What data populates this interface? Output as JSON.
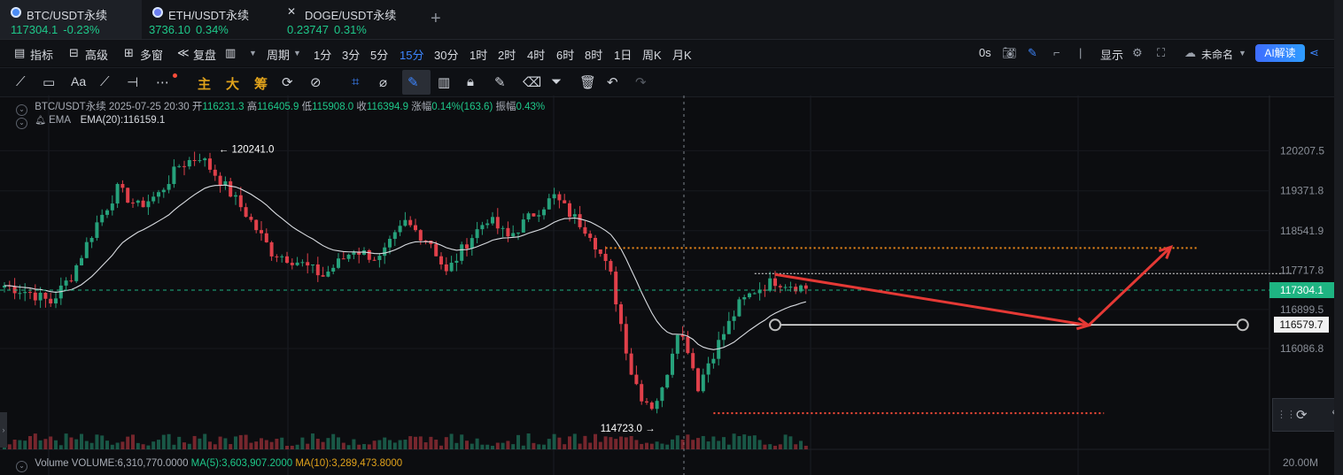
{
  "tabs": [
    {
      "symbol": "BTC/USDT永续",
      "price": "117304.1",
      "change": "-0.23%",
      "icon": "btc-logo-icon",
      "active": true
    },
    {
      "symbol": "ETH/USDT永续",
      "price": "3736.10",
      "change": "0.34%",
      "icon": "eth-logo-icon",
      "active": false
    },
    {
      "symbol": "DOGE/USDT永续",
      "price": "0.23747",
      "change": "0.31%",
      "icon": "close-icon",
      "active": false
    }
  ],
  "add_tab": "+",
  "toolbar": {
    "indicator": "指标",
    "advanced": "高级",
    "multi_window": "多窗",
    "replay": "复盘",
    "period": "周期",
    "intervals": [
      "1分",
      "3分",
      "5分",
      "15分",
      "30分",
      "1时",
      "2时",
      "4时",
      "6时",
      "8时",
      "1日",
      "周K",
      "月K"
    ],
    "active_interval": "15分",
    "countdown": "0s",
    "display": "显示",
    "unnamed": "未命名",
    "ai": "AI解读"
  },
  "draw_tools": {
    "main": "主",
    "big": "大",
    "chip": "筹",
    "text_tool": "Aa"
  },
  "legend": {
    "symbol": "BTC/USDT永续",
    "datetime": "2025-07-25 20:30",
    "open_label": "开",
    "open": "116231.3",
    "high_label": "高",
    "high": "116405.9",
    "low_label": "低",
    "low": "115908.0",
    "close_label": "收",
    "close": "116394.9",
    "change_label": "涨幅",
    "change": "0.14%(163.6)",
    "amplitude_label": "振幅",
    "amplitude": "0.43%",
    "ema_name": "EMA",
    "ema_value": "EMA(20):116159.1"
  },
  "volume_legend": {
    "name": "Volume",
    "volume": "VOLUME:6,310,770.0000",
    "ma5": "MA(5):3,603,907.2000",
    "ma10": "MA(10):3,289,473.8000"
  },
  "annotations": {
    "high_text": "120241.0",
    "low_text": "114723.0"
  },
  "price_tag": "117304.1",
  "line_tag": "116579.7",
  "colors": {
    "up": "#26a17b",
    "down": "#e0404a",
    "ema": "#d9dce1",
    "accent": "#3d86ff",
    "orange_level": "#f08a1a",
    "red_level": "#ff4d3a",
    "arrow": "#e53935"
  },
  "chart_data": {
    "type": "candlestick",
    "ylim": [
      114540,
      120620
    ],
    "y_ticks": [
      "120207.5",
      "119371.8",
      "118541.9",
      "117717.8",
      "116899.5",
      "116086.8"
    ],
    "volume_tick": "20.00M",
    "current_price": 117304.1,
    "key_points": [
      [
        0,
        117400
      ],
      [
        5,
        117250
      ],
      [
        9,
        117050
      ],
      [
        13,
        117600
      ],
      [
        18,
        118700
      ],
      [
        22,
        119400
      ],
      [
        26,
        119050
      ],
      [
        30,
        119300
      ],
      [
        34,
        119900
      ],
      [
        38,
        120100
      ],
      [
        42,
        119600
      ],
      [
        47,
        118900
      ],
      [
        52,
        118100
      ],
      [
        57,
        117900
      ],
      [
        62,
        117600
      ],
      [
        68,
        118150
      ],
      [
        73,
        117950
      ],
      [
        78,
        118700
      ],
      [
        83,
        118300
      ],
      [
        86,
        117650
      ],
      [
        90,
        118300
      ],
      [
        94,
        118800
      ],
      [
        98,
        118400
      ],
      [
        103,
        118900
      ],
      [
        107,
        119250
      ],
      [
        110,
        118900
      ],
      [
        114,
        118500
      ],
      [
        118,
        117600
      ],
      [
        120,
        116600
      ],
      [
        122,
        115600
      ],
      [
        124,
        115100
      ],
      [
        126,
        114900
      ],
      [
        128,
        115200
      ],
      [
        131,
        116500
      ],
      [
        133,
        116100
      ],
      [
        135,
        115300
      ],
      [
        137,
        115800
      ],
      [
        140,
        116400
      ],
      [
        143,
        117000
      ],
      [
        146,
        117300
      ],
      [
        150,
        117500
      ],
      [
        156,
        117350
      ]
    ],
    "levels": [
      {
        "type": "resistance",
        "price": 118180,
        "color": "orange",
        "from": 117,
        "to": 232
      },
      {
        "type": "support",
        "price": 114740,
        "color": "red",
        "from": 138,
        "to": 214
      },
      {
        "type": "horizontal-line",
        "price": 116579.7,
        "color": "white",
        "from": 150,
        "to": 241
      },
      {
        "type": "dotted",
        "price": 117650,
        "color": "white",
        "from": 146,
        "to": 251
      }
    ],
    "arrows": [
      [
        150,
        117630
      ],
      [
        211,
        116570
      ],
      [
        227,
        118200
      ]
    ]
  }
}
